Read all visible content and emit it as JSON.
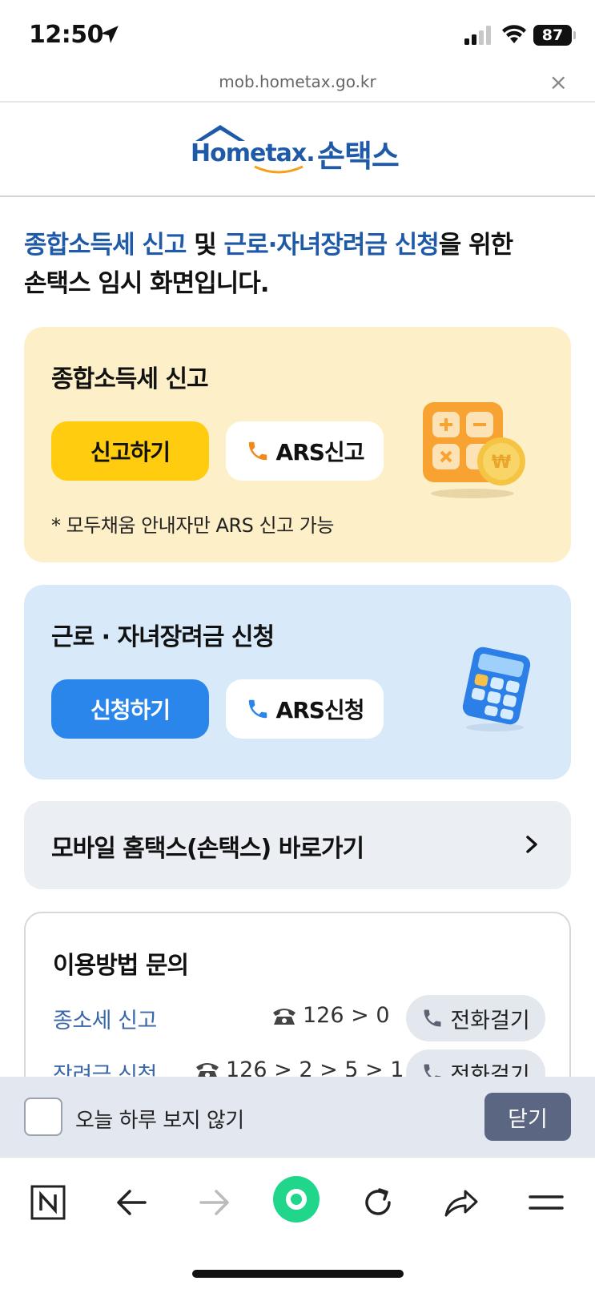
{
  "status_bar": {
    "time": "12:50",
    "battery": "87"
  },
  "browser": {
    "url": "mob.hometax.go.kr",
    "close_glyph": "×"
  },
  "header": {
    "logo_text": "Hometax.",
    "logo_korean": "손택스"
  },
  "intro": {
    "part1": "종합소득세 신고",
    "part2": " 및 ",
    "part3": "근로·자녀장려금 신청",
    "part4": "을 위한",
    "line2": "손택스 임시 화면입니다."
  },
  "income_tax_card": {
    "title": "종합소득세 신고",
    "primary_label": "신고하기",
    "ars_label": "ARS신고",
    "note": "* 모두채움 안내자만 ARS 신고 가능",
    "bg_color": "#fdefc8",
    "button_color": "#ffcc10"
  },
  "incentive_card": {
    "title": "근로 · 자녀장려금 신청",
    "primary_label": "신청하기",
    "ars_label": "ARS신청",
    "bg_color": "#d8eaf9",
    "button_color": "#2a86ea"
  },
  "shortcut": {
    "label": "모바일 홈택스(손택스) 바로가기",
    "icon": "chevron-right-icon"
  },
  "inquiry": {
    "title": "이용방법 문의",
    "rows": [
      {
        "label": "종소세 신고",
        "number": "126 > 0",
        "call_label": "전화걸기"
      },
      {
        "label": "장려금 신청",
        "number": "126 > 2 > 5 > 1",
        "call_label": "전화걸기"
      }
    ]
  },
  "bottom_banner": {
    "checkbox_label": "오늘 하루 보지 않기",
    "close_label": "닫기"
  },
  "toolbar": {
    "icons": [
      "naver-n-icon",
      "back-arrow-icon",
      "forward-arrow-icon",
      "green-home-icon",
      "reload-icon",
      "share-icon",
      "menu-icon"
    ]
  },
  "colors": {
    "brand_blue": "#1f5aa8",
    "accent_green": "#1fd68a"
  }
}
